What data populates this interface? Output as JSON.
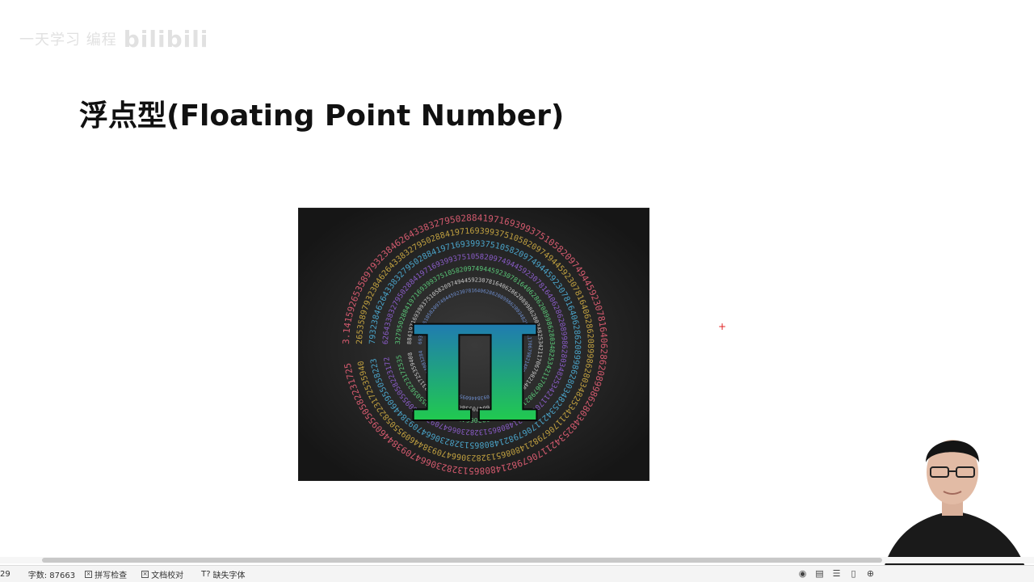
{
  "watermark": {
    "text": "一天学习 编程",
    "logo": "bilibili"
  },
  "slide": {
    "title": "浮点型(Floating Point Number)",
    "image_symbol": "π",
    "image_digits": "3.14159265358979323846264338327950288419716939937510582097494459230781640628620899862803482534211706798214808651328230664709384460955058223172535940812848111745028410270193852110555964462294895493038196"
  },
  "statusbar": {
    "page_fragment": "29",
    "word_count": "字数: 87663",
    "spell_check": "拼写检查",
    "doc_proof": "文档校对",
    "missing_font": "缺失字体"
  },
  "colors": {
    "accent_cursor": "#e02020",
    "pi_top": "#1e3cff",
    "pi_bottom": "#22ee22"
  }
}
